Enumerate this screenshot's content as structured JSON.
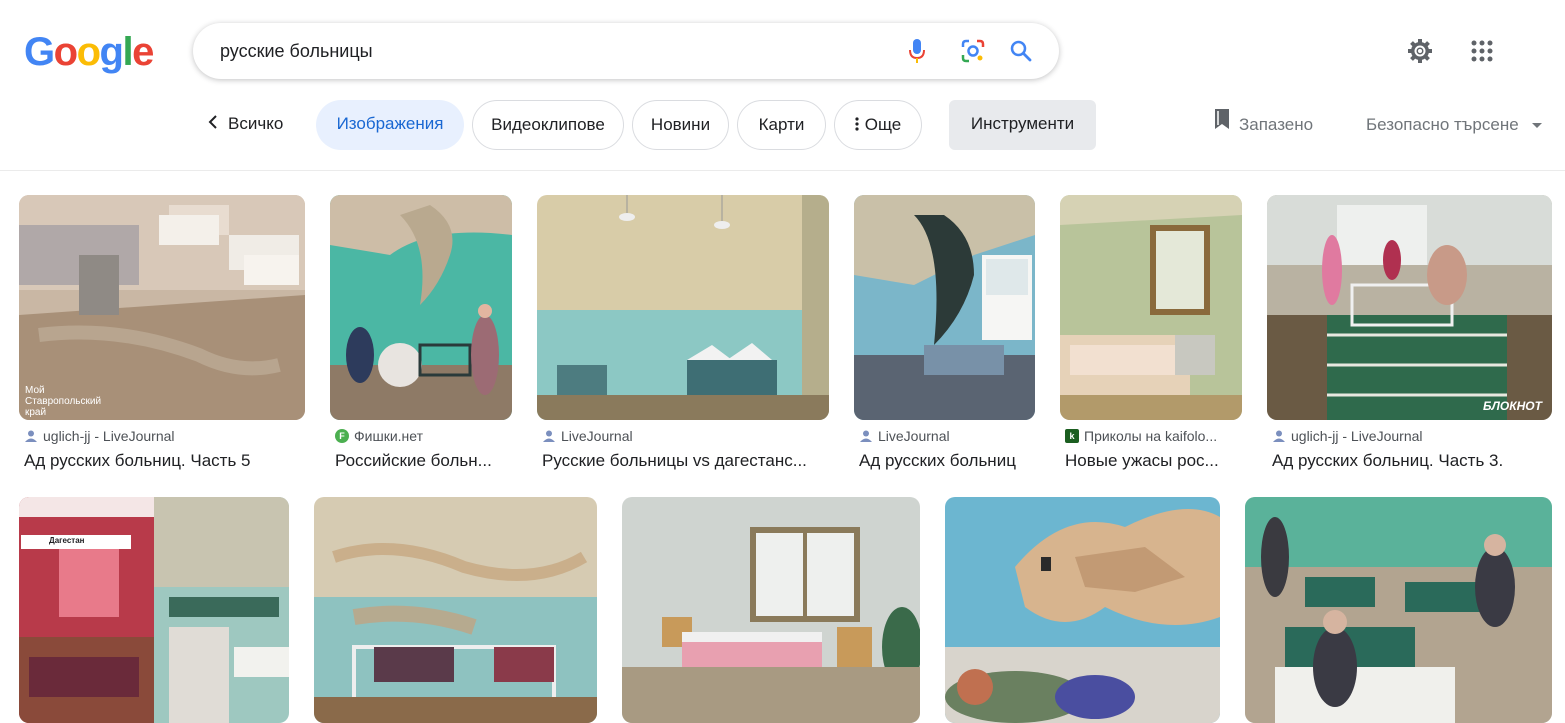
{
  "logo": {
    "letters": [
      "G",
      "o",
      "o",
      "g",
      "l",
      "e"
    ],
    "colors": [
      "#4285f4",
      "#ea4335",
      "#fbbc05",
      "#4285f4",
      "#34a853",
      "#ea4335"
    ]
  },
  "search": {
    "query": "русские больницы"
  },
  "chips": {
    "back": "Всичко",
    "images": "Изображения",
    "videos": "Видеоклипове",
    "news": "Новини",
    "maps": "Карти",
    "more": "Още",
    "tools": "Инструменти"
  },
  "saved": "Запазено",
  "safe_search": "Безопасно търсене",
  "results": [
    {
      "source": "uglich-jj - LiveJournal",
      "title": "Ад русских больниц. Часть 5",
      "favicon": "lj",
      "watermark": "Мой Ставропольский край"
    },
    {
      "source": "Фишки.нет",
      "title": "Российские больн...",
      "favicon": "f",
      "favicon_letter": "F"
    },
    {
      "source": "LiveJournal",
      "title": "Русские больницы vs дагестанс...",
      "favicon": "lj"
    },
    {
      "source": "LiveJournal",
      "title": "Ад русских больниц",
      "favicon": "lj"
    },
    {
      "source": "Приколы на kaifolo...",
      "title": "Новые ужасы рос...",
      "favicon": "k",
      "favicon_letter": "k"
    },
    {
      "source": "uglich-jj - LiveJournal",
      "title": "Ад русских больниц. Часть 3.",
      "favicon": "lj",
      "watermark": "БЛОКНОТ"
    },
    {
      "source": "",
      "title": "",
      "favicon": "",
      "watermark": "Дагестан"
    },
    {
      "source": "",
      "title": "",
      "favicon": ""
    },
    {
      "source": "",
      "title": "",
      "favicon": ""
    },
    {
      "source": "",
      "title": "",
      "favicon": ""
    },
    {
      "source": "",
      "title": "",
      "favicon": ""
    }
  ]
}
